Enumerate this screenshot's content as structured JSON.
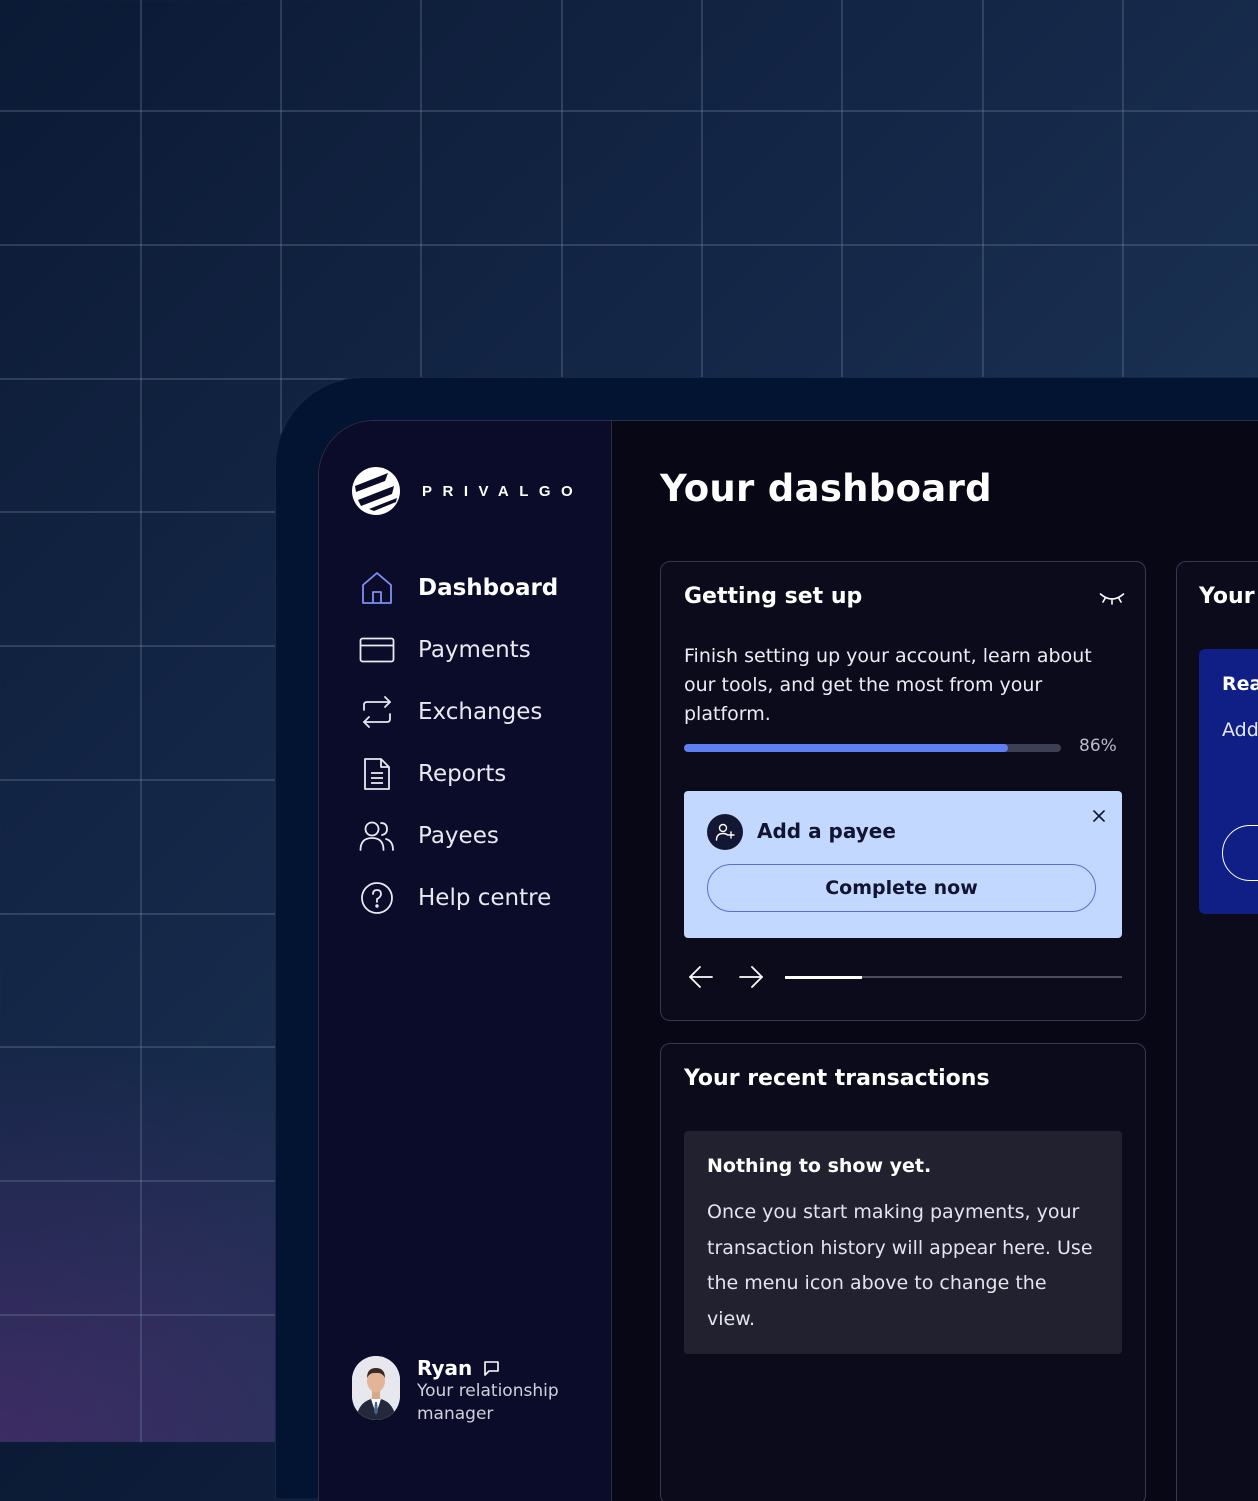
{
  "brand": {
    "name": "PRIVALGO"
  },
  "sidebar": {
    "items": [
      {
        "label": "Dashboard",
        "icon": "home-icon",
        "active": true
      },
      {
        "label": "Payments",
        "icon": "card-icon",
        "active": false
      },
      {
        "label": "Exchanges",
        "icon": "exchange-icon",
        "active": false
      },
      {
        "label": "Reports",
        "icon": "document-icon",
        "active": false
      },
      {
        "label": "Payees",
        "icon": "users-icon",
        "active": false
      },
      {
        "label": "Help centre",
        "icon": "help-icon",
        "active": false
      }
    ],
    "manager": {
      "name": "Ryan",
      "role": "Your relationship manager",
      "icon": "message-icon"
    }
  },
  "main": {
    "title": "Your dashboard",
    "setup": {
      "title": "Getting set up",
      "description": "Finish setting up your account, learn about our tools, and get the most from your platform.",
      "progress_percent": 86,
      "progress_label": "86%",
      "task": {
        "title": "Add a payee",
        "button": "Complete now",
        "icon": "add-user-icon"
      },
      "carousel_position": 0.23
    },
    "transactions": {
      "title": "Your recent transactions",
      "empty_title": "Nothing to show yet.",
      "empty_text": "Once you start making payments, your transaction history will appear here. Use the menu icon above to change the view."
    },
    "right_card": {
      "title": "Your l",
      "promo_title": "Rea",
      "promo_text": "Add avai here"
    }
  },
  "colors": {
    "accent": "#5e7ff0",
    "sidebar_bg": "#0b0b2a",
    "app_bg": "#080716",
    "task_bg": "#c2d8ff",
    "promo_bg": "#0f1f86"
  }
}
